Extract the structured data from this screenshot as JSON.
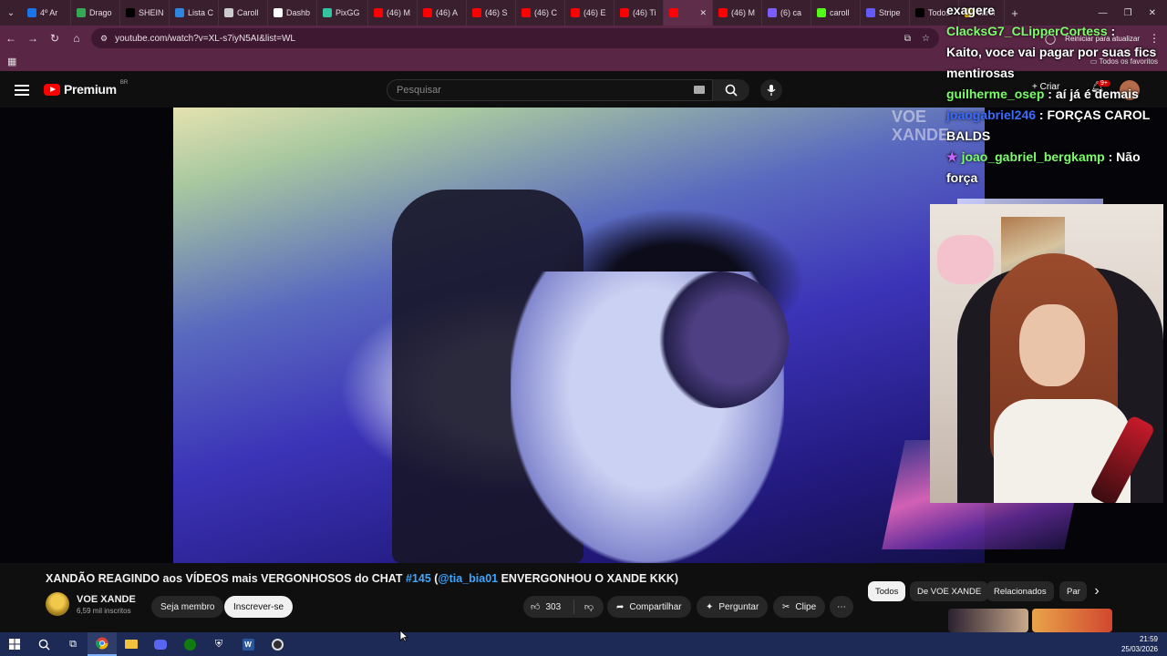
{
  "browser": {
    "tabs": [
      {
        "label": "4º Ar",
        "color": "#1a73e8"
      },
      {
        "label": "Drago",
        "color": "#34a853"
      },
      {
        "label": "SHEIN",
        "color": "#000000"
      },
      {
        "label": "Lista C",
        "color": "#2e86de"
      },
      {
        "label": "Caroll",
        "color": "#cccccc"
      },
      {
        "label": "Dashb",
        "color": "#ffffff"
      },
      {
        "label": "PixGG",
        "color": "#33c3a0"
      },
      {
        "label": "(46) M",
        "color": "#ff0000"
      },
      {
        "label": "(46) A",
        "color": "#ff0000"
      },
      {
        "label": "(46) S",
        "color": "#ff0000"
      },
      {
        "label": "(46) C",
        "color": "#ff0000"
      },
      {
        "label": "(46) E",
        "color": "#ff0000"
      },
      {
        "label": "(46) Ti",
        "color": "#ff0000"
      },
      {
        "label": "",
        "color": "#ff0000",
        "active": true
      },
      {
        "label": "(46) M",
        "color": "#ff0000"
      },
      {
        "label": "(6) ca",
        "color": "#7b5cff"
      },
      {
        "label": "caroll",
        "color": "#53fc18"
      },
      {
        "label": "Stripe",
        "color": "#635bff"
      },
      {
        "label": "Todos",
        "color": "#000000"
      },
      {
        "label": "carol",
        "color": "#f6c200"
      }
    ],
    "url": "youtube.com/watch?v=XL-s7iyN5AI&list=WL",
    "update_label": "Reiniciar para atualizar",
    "all_bookmarks": "Todos os favoritos"
  },
  "youtube": {
    "logo_text": "Premium",
    "country": "BR",
    "search_placeholder": "Pesquisar",
    "create_label": "Criar",
    "notif_count": "9+",
    "watermark": "VOE XANDE",
    "video_title_main": "XANDÃO REAGINDO aos VÍDEOS mais VERGONHOSOS do CHAT ",
    "video_title_tag": "#145",
    "video_title_paren_open": " (",
    "video_title_mention": "@tia_bia01",
    "video_title_rest": " ENVERGONHOU O XANDE KKK)",
    "channel_name": "VOE XANDE",
    "subscribers": "6,59 mil inscritos",
    "member_label": "Seja membro",
    "subscribe_label": "Inscrever-se",
    "likes": "303",
    "share_label": "Compartilhar",
    "ask_label": "Perguntar",
    "clip_label": "Clipe",
    "chips": [
      "Todos",
      "De VOE XANDE",
      "Relacionados",
      "Par"
    ]
  },
  "chat": {
    "messages": [
      {
        "user": "",
        "text": "exagere",
        "color": "#ffffff"
      },
      {
        "user": "ClacksG7_CLipperCortess",
        "text": " :",
        "color": "#7cfc6a"
      },
      {
        "user": "",
        "text": "Kaito, voce vai pagar por suas fics mentirosas",
        "color": "#ffffff"
      },
      {
        "user": "guilherme_osep",
        "text": " : aí já é demais",
        "color": "#7cfc6a"
      },
      {
        "user": "joaogabriel246",
        "text": " : FORÇAS CAROL BALDS",
        "color": "#3a6bff"
      },
      {
        "user": "joao_gabriel_bergkamp",
        "text": " : Não força",
        "color": "#7cfc6a",
        "star": true
      }
    ]
  },
  "taskbar": {
    "time": "21:59",
    "date": "25/03/2026"
  }
}
